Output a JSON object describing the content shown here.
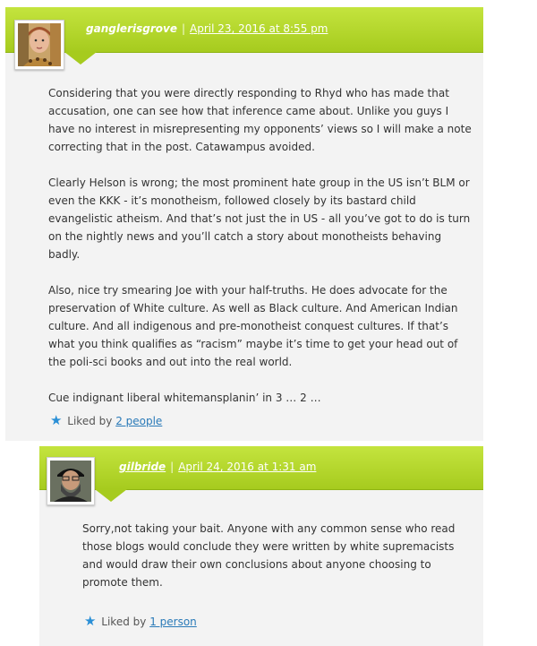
{
  "comments": [
    {
      "author": "ganglerisgrove",
      "date": "April 23, 2016 at 8:55 pm",
      "separator": "|",
      "paragraphs": [
        "Considering that you were directly responding to Rhyd who has made that accusation, one can see how that inference came about. Unlike you guys I have no interest in misrepresenting my opponents’ views so I will make a note correcting that in the post. Catawampus avoided.",
        "Clearly Helson is wrong; the most prominent hate group in the US isn’t BLM or even the KKK - it’s monotheism, followed closely by its bastard child evangelistic atheism. And that’s not just the in US - all you’ve got to do is turn on the nightly news and you’ll catch a story about monotheists behaving badly.",
        "Also, nice try smearing Joe with your half-truths. He does advocate for the preservation of White culture. As well as Black culture. And American Indian culture. And all indigenous and pre-monotheist conquest cultures. If that’s what you think qualifies as “racism” maybe it’s time to get your head out of the poli-sci books and out into the real world.",
        "Cue indignant liberal whitemansplanin’ in 3 … 2 …"
      ],
      "likes_prefix": "Liked by",
      "likes_link": "2 people"
    },
    {
      "author": "gilbride",
      "date": "April 24, 2016 at 1:31 am",
      "separator": "|",
      "paragraphs": [
        "Sorry,not taking your bait. Anyone with any common sense who read those blogs would conclude they were written by white supremacists and would draw their own conclusions about anyone choosing to promote them."
      ],
      "likes_prefix": "Liked by",
      "likes_link": "1 person"
    }
  ],
  "colors": {
    "header_green": "#a6cb1e",
    "comment_bg": "#f3f3f3",
    "link_blue": "#2a7ab8",
    "star_blue": "#2a8fd6"
  },
  "icons": {
    "like": "star-icon"
  }
}
